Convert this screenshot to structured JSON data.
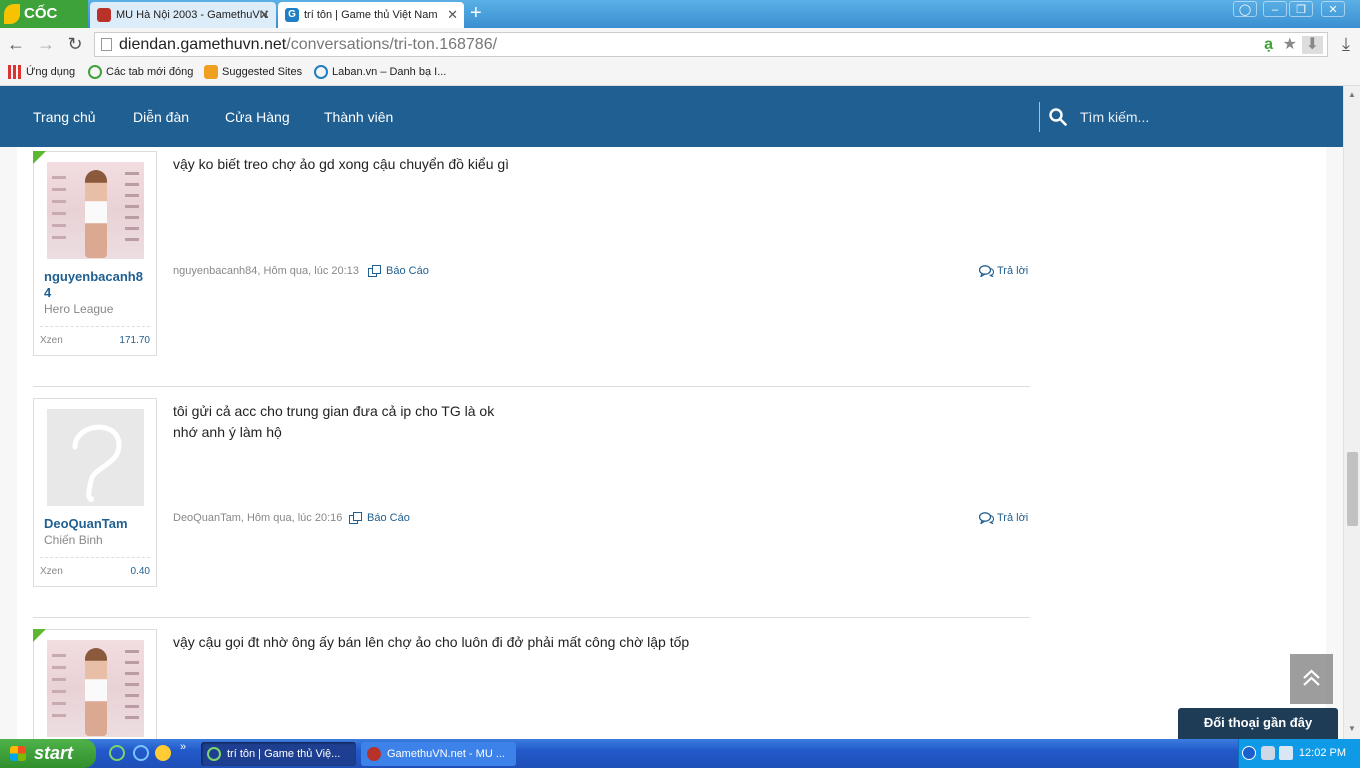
{
  "browser": {
    "brand": "CỐC CỐC",
    "tabs": [
      {
        "title": "MU Hà Nội 2003 - GamethuVN",
        "active": false
      },
      {
        "title": "trí tôn | Game thủ Việt Nam",
        "active": true
      }
    ],
    "url_host": "diendan.gamethuvn.net",
    "url_path": "/conversations/tri-ton.168786/",
    "bookmarks": [
      "Ứng dụng",
      "Các tab mới đóng",
      "Suggested Sites",
      "Laban.vn – Danh bạ I..."
    ]
  },
  "site": {
    "nav": [
      "Trang chủ",
      "Diễn đàn",
      "Cửa Hàng",
      "Thành viên"
    ],
    "search_placeholder": "Tìm kiếm...",
    "report_label": "Báo Cáo",
    "reply_label": "Trả lời",
    "recent_conversations": "Đối thoại gần đây",
    "colors": {
      "nav": "#1f5f91",
      "link": "#1f5f91",
      "staff_badge": "#5cb82e"
    }
  },
  "posts": [
    {
      "username": "nguyenbacanh84",
      "user_title": "Hero League",
      "stat_label": "Xzen",
      "stat_value": "171.70",
      "avatar": "photo",
      "message": [
        "vậy ko biết treo chợ ảo gd xong cậu chuyển đồ kiểu gì"
      ],
      "meta": "nguyenbacanh84, Hôm qua, lúc 20:13"
    },
    {
      "username": "DeoQuanTam",
      "user_title": "Chiến Binh",
      "stat_label": "Xzen",
      "stat_value": "0.40",
      "avatar": "blank",
      "message": [
        "tôi gửi cả acc cho trung gian đưa cả ip cho TG là ok",
        "nhớ anh ý làm hộ"
      ],
      "meta": "DeoQuanTam, Hôm qua, lúc 20:16"
    },
    {
      "avatar": "photo",
      "message": [
        "vậy cậu gọi đt nhờ ông ấy bán lên chợ ảo cho luôn đi đở phải mất công chờ lập tốp"
      ]
    }
  ],
  "taskbar": {
    "start": "start",
    "tasks": [
      "trí tôn | Game thủ Việ...",
      "GamethuVN.net - MU ..."
    ],
    "clock": "12:02 PM"
  }
}
